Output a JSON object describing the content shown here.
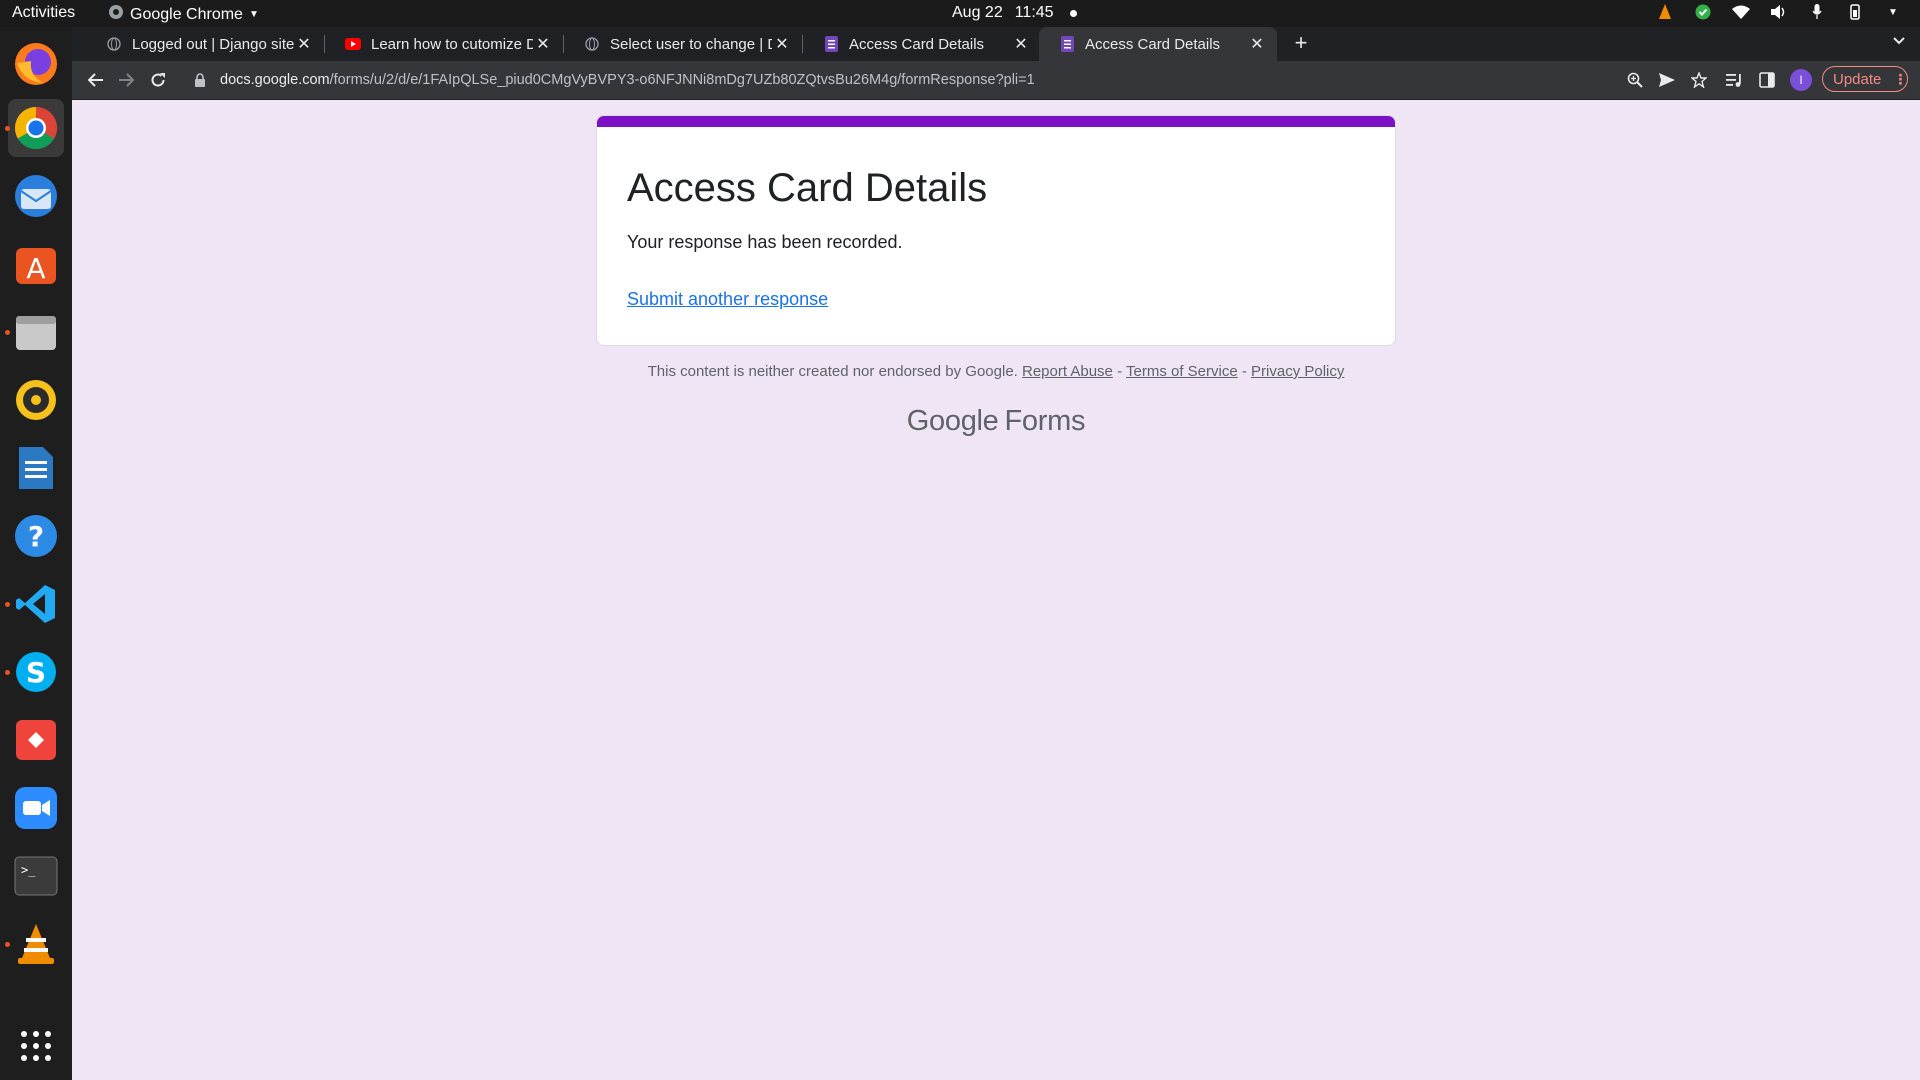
{
  "topbar": {
    "activities": "Activities",
    "app_name": "Google Chrome",
    "date": "Aug 22",
    "time": "11:45"
  },
  "dock": {
    "apps": [
      "firefox",
      "chrome",
      "thunderbird",
      "app-center",
      "files",
      "rhythmbox",
      "libreoffice-writer",
      "help",
      "vscode",
      "skype",
      "anydesk",
      "zoom",
      "terminal",
      "vlc",
      "show-apps"
    ]
  },
  "tabs": [
    {
      "title": "Logged out | Django site admin",
      "favicon": "globe-icon"
    },
    {
      "title": "Learn how to cutomize Django",
      "favicon": "youtube-icon"
    },
    {
      "title": "Select user to change | Django",
      "favicon": "globe-icon"
    },
    {
      "title": "Access Card Details",
      "favicon": "forms-icon"
    },
    {
      "title": "Access Card Details",
      "favicon": "forms-icon",
      "active": true
    }
  ],
  "toolbar": {
    "url_domain": "docs.google.com",
    "url_path": "/forms/u/2/d/e/1FAIpQLSe_piud0CMgVyBVPY3-o6NFJNNi8mDg7UZb80ZQtvsBu26M4g/formResponse?pli=1",
    "profile_initial": "I",
    "update_label": "Update"
  },
  "form": {
    "title": "Access Card Details",
    "message": "Your response has been recorded.",
    "link": "Submit another response"
  },
  "footer": {
    "disclaimer": "This content is neither created nor endorsed by Google.",
    "report": "Report Abuse",
    "terms": "Terms of Service",
    "privacy": "Privacy Policy",
    "sep": "-"
  },
  "brand": {
    "google": "Google",
    "product": "Forms"
  },
  "colors": {
    "form_accent": "#7b10c4",
    "page_bg": "#f0e5f5",
    "link": "#1a73e8"
  }
}
